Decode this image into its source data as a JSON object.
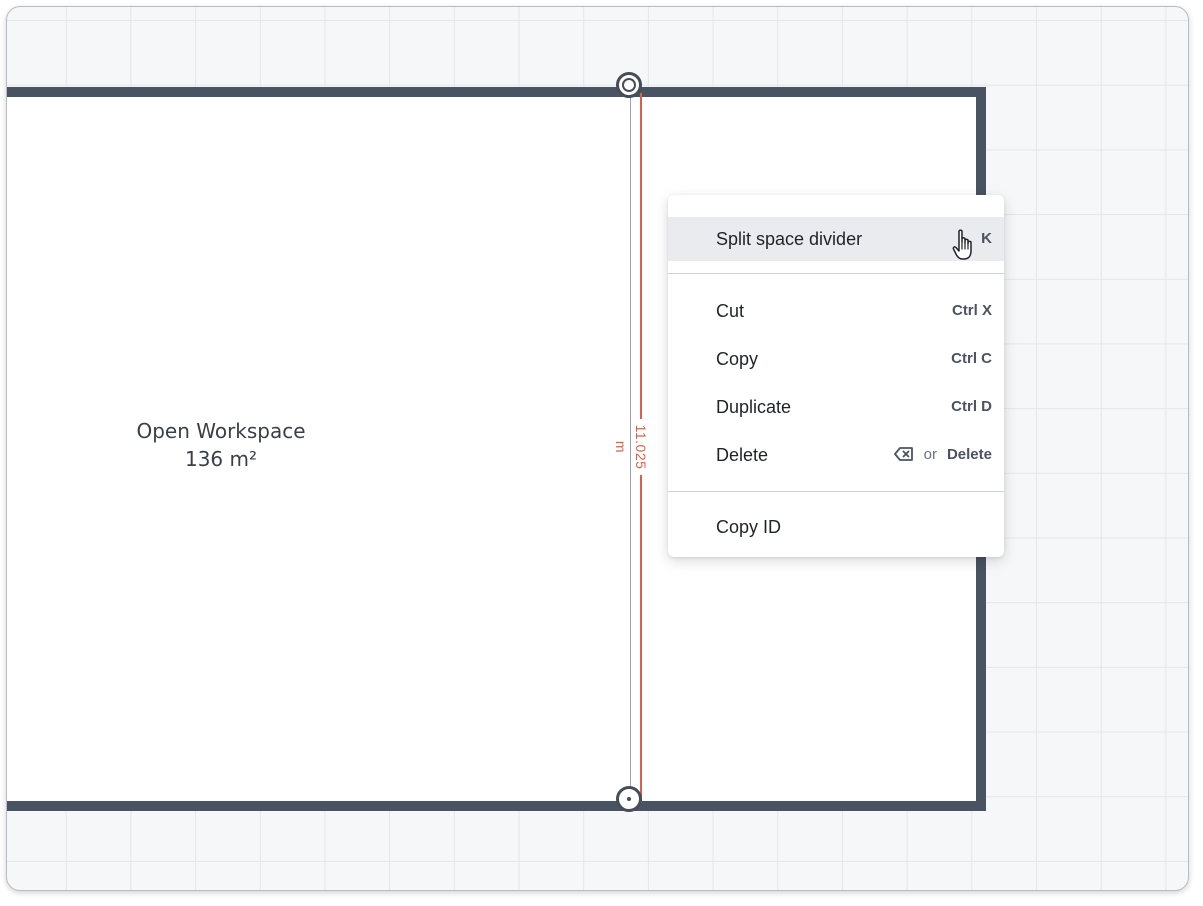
{
  "canvas": {
    "room": {
      "name": "Open Workspace",
      "area": "136 m²"
    },
    "divider": {
      "length_label": "11.025 m"
    },
    "colors": {
      "wall": "#4a5361",
      "measure": "#d46349",
      "grid": "#e3e6ea",
      "background": "#f6f7f9"
    }
  },
  "context_menu": {
    "items": [
      {
        "label": "Split space divider",
        "shortcut": "K",
        "active": true
      },
      {
        "label": "Cut",
        "shortcut": "Ctrl X"
      },
      {
        "label": "Copy",
        "shortcut": "Ctrl C"
      },
      {
        "label": "Duplicate",
        "shortcut": "Ctrl D"
      },
      {
        "label": "Delete",
        "shortcut_icon": "backspace-icon",
        "shortcut_or": "or",
        "shortcut": "Delete"
      },
      {
        "label": "Copy ID"
      }
    ]
  },
  "pointer": {
    "icon": "hand-pointer-icon"
  }
}
